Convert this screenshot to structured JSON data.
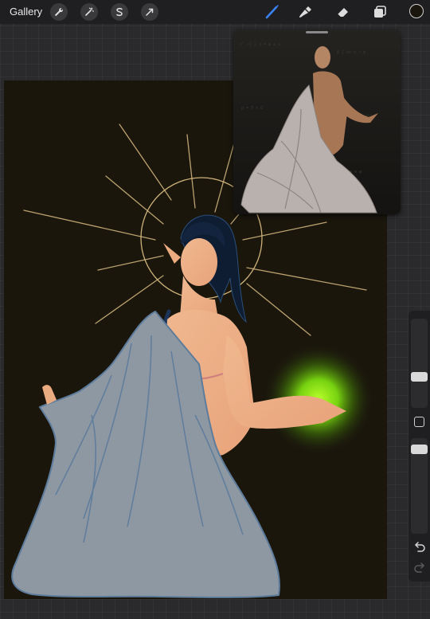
{
  "toolbar": {
    "gallery_label": "Gallery",
    "left_tools": [
      "wrench-icon",
      "magic-wand-icon",
      "selection-icon",
      "transform-icon"
    ],
    "right_tools": [
      "brush-icon",
      "smudge-icon",
      "eraser-icon",
      "layers-icon"
    ],
    "active_tool": "brush-icon",
    "accent_color": "#3b82f6",
    "current_color": "#1a160e"
  },
  "canvas": {
    "background_color": "#1a160c",
    "subject": "painted figure with halo, draped grey cloth and glowing green orb"
  },
  "reference": {
    "kind": "photo reference window"
  },
  "sidebar": {
    "brush_size_level": 0.45,
    "opacity_level": 0.3,
    "undo_icon": "undo-icon",
    "redo_icon": "redo-icon"
  }
}
